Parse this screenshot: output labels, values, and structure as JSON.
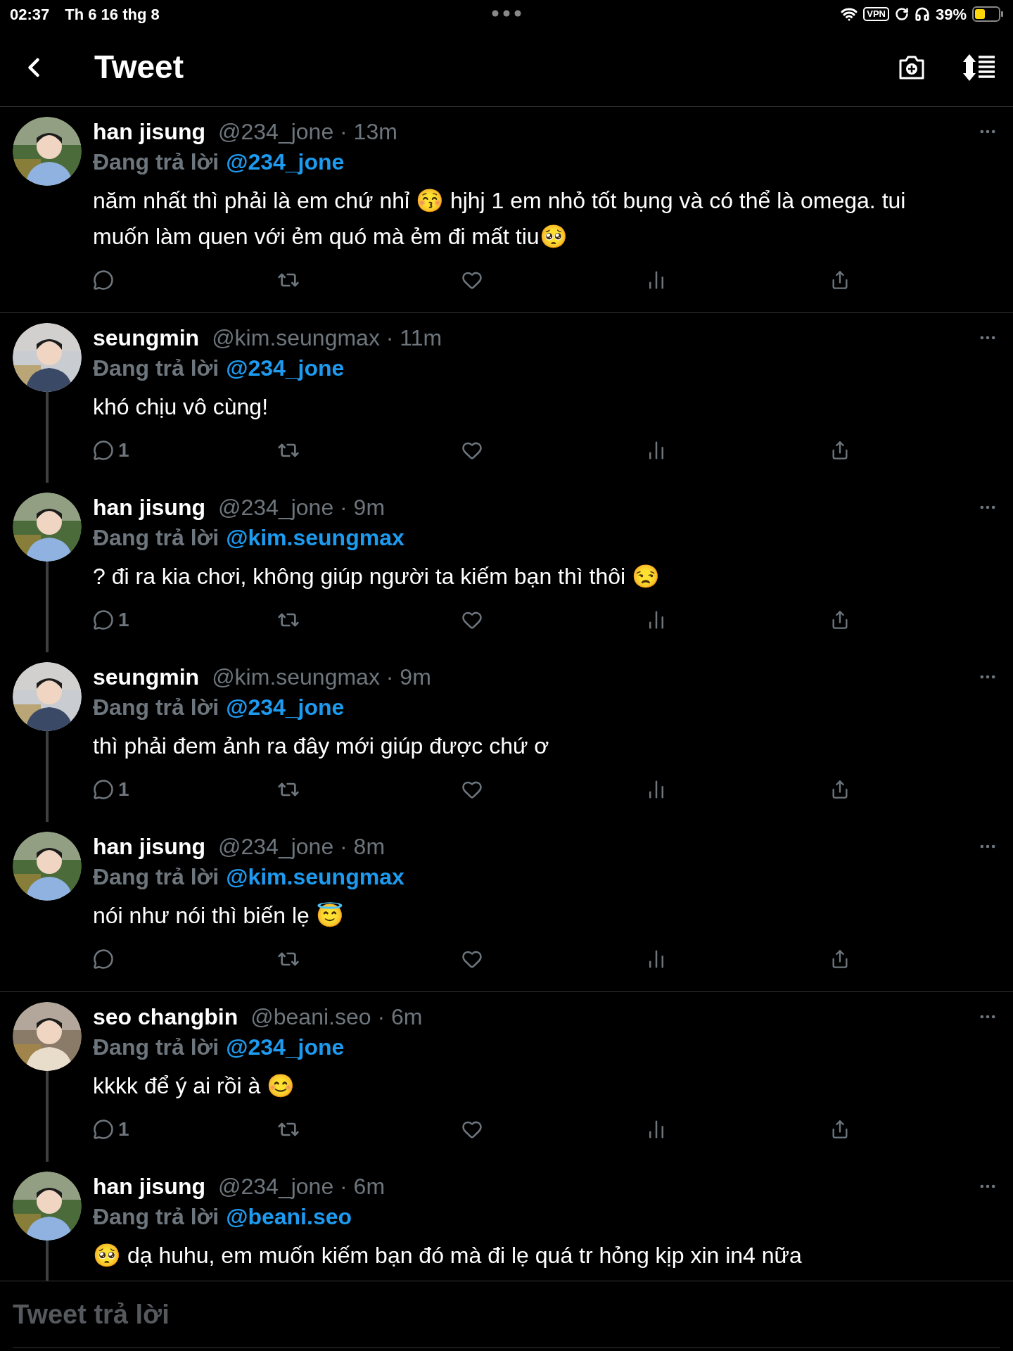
{
  "status_bar": {
    "time": "02:37",
    "date": "Th 6 16 thg 8",
    "vpn": "VPN",
    "battery": "39%"
  },
  "header": {
    "title": "Tweet"
  },
  "sections": [
    {
      "tweets": [
        {
          "name": "han jisung",
          "meta": "@234_jone · 13m",
          "reply_label": "Đang trả lời",
          "reply_to": "@234_jone",
          "text": "năm nhất thì phải là em chứ nhỉ 😚 hjhj 1 em nhỏ tốt bụng và có thể là omega. tui muốn làm quen với ẻm quó mà ẻm đi mất tiu🥺",
          "thread_line": false
        }
      ]
    },
    {
      "tweets": [
        {
          "name": "seungmin",
          "meta": "@kim.seungmax · 11m",
          "reply_label": "Đang trả lời",
          "reply_to": "@234_jone",
          "text": "khó chịu vô cùng!",
          "replies": "1",
          "thread_line": true
        },
        {
          "name": "han jisung",
          "meta": "@234_jone · 9m",
          "reply_label": "Đang trả lời",
          "reply_to": "@kim.seungmax",
          "text": "? đi ra kia chơi, không giúp người ta kiếm bạn thì thôi 😒",
          "replies": "1",
          "thread_line": true
        },
        {
          "name": "seungmin",
          "meta": "@kim.seungmax · 9m",
          "reply_label": "Đang trả lời",
          "reply_to": "@234_jone",
          "text": "thì phải đem ảnh ra đây mới giúp được chứ ơ",
          "replies": "1",
          "thread_line": true
        },
        {
          "name": "han jisung",
          "meta": "@234_jone · 8m",
          "reply_label": "Đang trả lời",
          "reply_to": "@kim.seungmax",
          "text": "nói như nói thì biến lẹ 😇",
          "thread_line": false
        }
      ]
    },
    {
      "tweets": [
        {
          "name": "seo changbin",
          "meta": "@beani.seo · 6m",
          "reply_label": "Đang trả lời",
          "reply_to": "@234_jone",
          "text": "kkkk để ý ai rồi à 😊",
          "replies": "1",
          "thread_line": true
        },
        {
          "name": "han jisung",
          "meta": "@234_jone · 6m",
          "reply_label": "Đang trả lời",
          "reply_to": "@beani.seo",
          "text": "🥺 dạ huhu, em muốn kiếm bạn đó mà đi lẹ quá tr hỏng kịp xin in4 nữa",
          "thread_line": true,
          "cut_off": true
        }
      ]
    }
  ],
  "compose": {
    "placeholder": "Tweet trả lời"
  }
}
